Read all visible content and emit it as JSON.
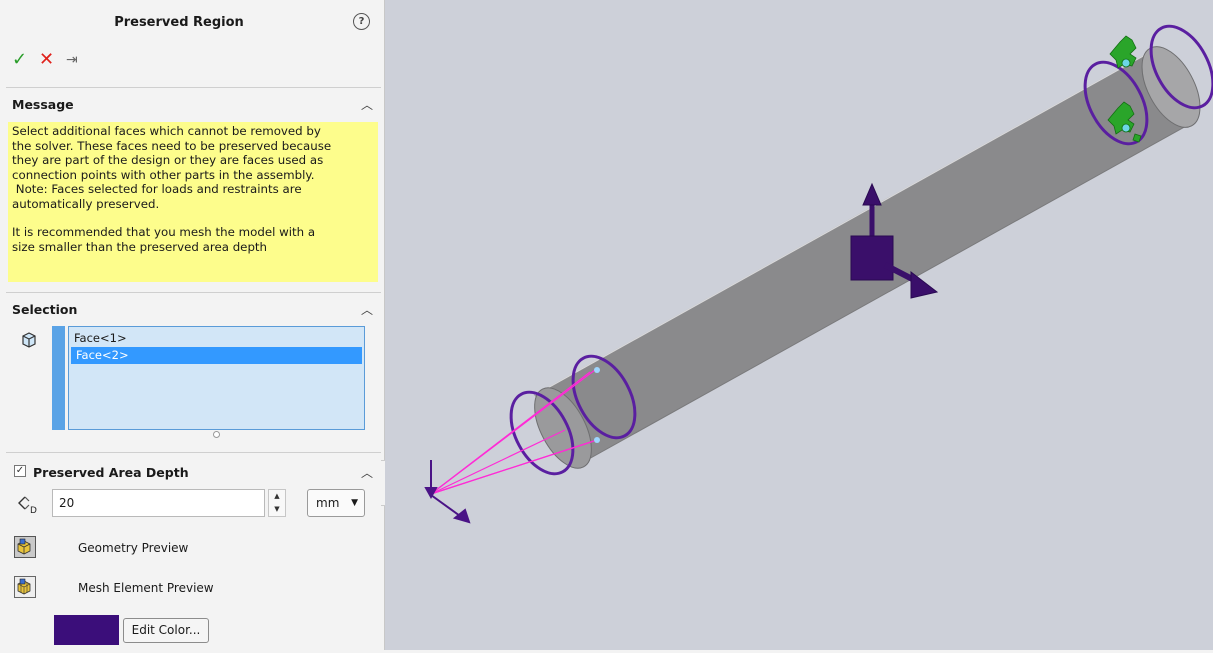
{
  "panel": {
    "title": "Preserved Region",
    "help_icon": "?",
    "actions": {
      "ok": "✓",
      "cancel": "✕",
      "pin": "⇥"
    },
    "message": {
      "header": "Message",
      "paragraph1": "Select additional faces which cannot be removed by\nthe solver. These faces need to be preserved because\nthey are part of the design or they are faces used as\nconnection points with other parts in the assembly.\n Note: Faces selected for loads and restraints are\nautomatically preserved.",
      "paragraph2": "It is recommended that you mesh the model with a\nsize smaller than the preserved area depth",
      "bg_color": "#fdfd8c"
    },
    "selection": {
      "header": "Selection",
      "items": [
        {
          "label": "Face<1>",
          "selected": false
        },
        {
          "label": "Face<2>",
          "selected": true
        }
      ]
    },
    "depth": {
      "header": "Preserved Area Depth",
      "checked": true,
      "value": "20",
      "unit": "mm",
      "geometry_preview_label": "Geometry Preview",
      "mesh_preview_label": "Mesh Element Preview",
      "edit_color_label": "Edit Color...",
      "swatch_color": "#3b0e7a"
    }
  },
  "viewport": {
    "background": "#cdd0d9",
    "pipe_color": "#9a9a9c",
    "ring_color": "#5a1fa0",
    "triad_color": "#3a0f6a"
  }
}
